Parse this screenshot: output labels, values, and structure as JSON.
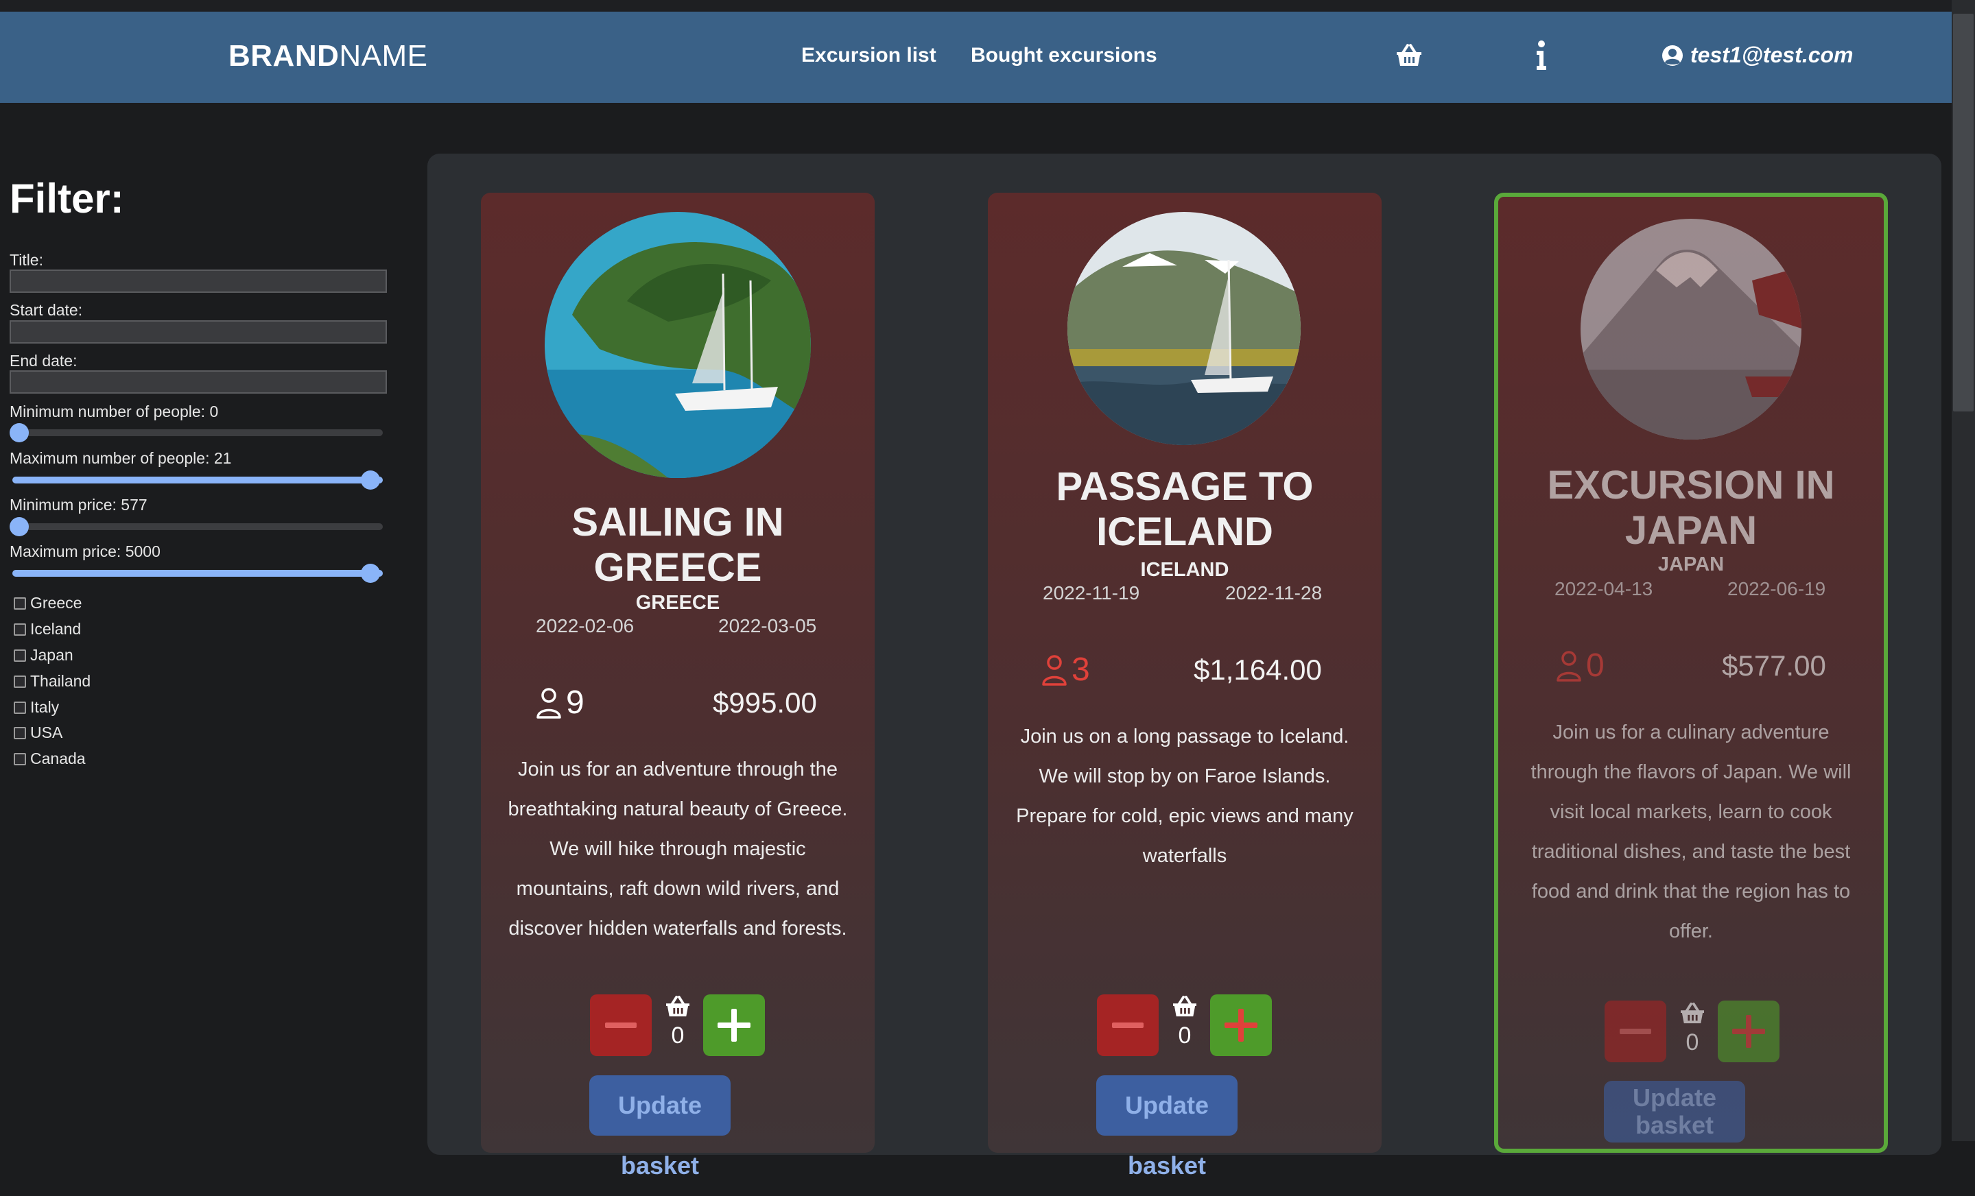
{
  "navbar": {
    "brand_bold": "BRAND",
    "brand_thin": "NAME",
    "links": [
      "Excursion list",
      "Bought excursions"
    ],
    "cart_icon": "basket-icon",
    "info_icon": "info-icon",
    "user_email": "test1@test.com"
  },
  "filter": {
    "heading": "Filter:",
    "title_label": "Title:",
    "start_label": "Start date:",
    "end_label": "End date:",
    "min_people_label": "Minimum number of people: 0",
    "max_people_label": "Maximum number of people: 21",
    "min_price_label": "Minimum price: 577",
    "max_price_label": "Maximum price: 5000",
    "min_people_level": 0,
    "max_people_level": 1,
    "min_price_level": 0,
    "max_price_level": 1,
    "countries": [
      "Greece",
      "Iceland",
      "Japan",
      "Thailand",
      "Italy",
      "USA",
      "Canada"
    ]
  },
  "excursions": [
    {
      "title": "SAILING IN GREECE",
      "title_line1": "SAILING IN",
      "title_line2": "GREECE",
      "country": "GREECE",
      "start": "2022-02-06",
      "end": "2022-03-05",
      "people": "9",
      "price": "$995.00",
      "description": "Join us for an adventure through the breathtaking natural beauty of Greece. We will hike through majestic mountains, raft down wild rivers, and discover hidden waterfalls and forests.",
      "quantity": "0",
      "update_label": "Update basket"
    },
    {
      "title": "PASSAGE TO ICELAND",
      "title_line1": "PASSAGE TO",
      "title_line2": "ICELAND",
      "country": "ICELAND",
      "start": "2022-11-19",
      "end": "2022-11-28",
      "people": "3",
      "price": "$1,164.00",
      "description": "Join us on a long passage to Iceland. We will stop by on Faroe Islands. Prepare for cold, epic views and many waterfalls",
      "quantity": "0",
      "update_label": "Update basket"
    },
    {
      "title": "EXCURSION IN JAPAN",
      "title_line1": "EXCURSION IN",
      "title_line2": "JAPAN",
      "country": "JAPAN",
      "start": "2022-04-13",
      "end": "2022-06-19",
      "people": "0",
      "price": "$577.00",
      "description": "Join us for a culinary adventure through the flavors of Japan. We will visit local markets, learn to cook traditional dishes, and taste the best food and drink that the region has to offer.",
      "quantity": "0",
      "update_label_1": "Update",
      "update_label_2": "basket"
    }
  ],
  "colors": {
    "navbar": "#3a6187",
    "card_active_border": "#5aa93a",
    "low_people_red": "#e0413a",
    "minus_button": "#a52424",
    "plus_button": "#4e9b2a",
    "update_button": "#3d5fa0"
  }
}
